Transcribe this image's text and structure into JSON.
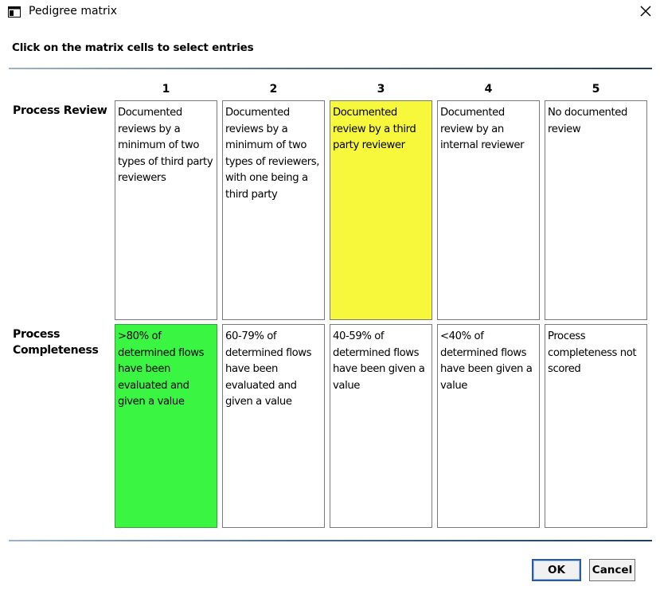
{
  "window": {
    "title": "Pedigree matrix",
    "close_glyph": "✕"
  },
  "instruction": "Click on the matrix cells to select entries",
  "columns": [
    "1",
    "2",
    "3",
    "4",
    "5"
  ],
  "rows": [
    {
      "label": "Process Review",
      "selected_column": "3",
      "selection_color": "#f7f73b",
      "cells": [
        "Documented reviews by a minimum of two types of third party reviewers",
        "Documented reviews by a minimum of two types of reviewers, with one being a third party",
        "Documented review by a third party reviewer",
        "Documented review by an internal reviewer",
        "No documented review"
      ]
    },
    {
      "label": "Process Completeness",
      "selected_column": "1",
      "selection_color": "#3af542",
      "cells": [
        ">80% of determined flows have been evaluated and given a value",
        "60-79% of determined flows have been evaluated and given a value",
        "40-59% of determined flows have been given a value",
        "<40% of determined flows have been given a value",
        "Process completeness not scored"
      ]
    }
  ],
  "buttons": {
    "ok": "OK",
    "cancel": "Cancel"
  },
  "icons": {
    "app": "window-app-icon",
    "close": "close-icon"
  }
}
